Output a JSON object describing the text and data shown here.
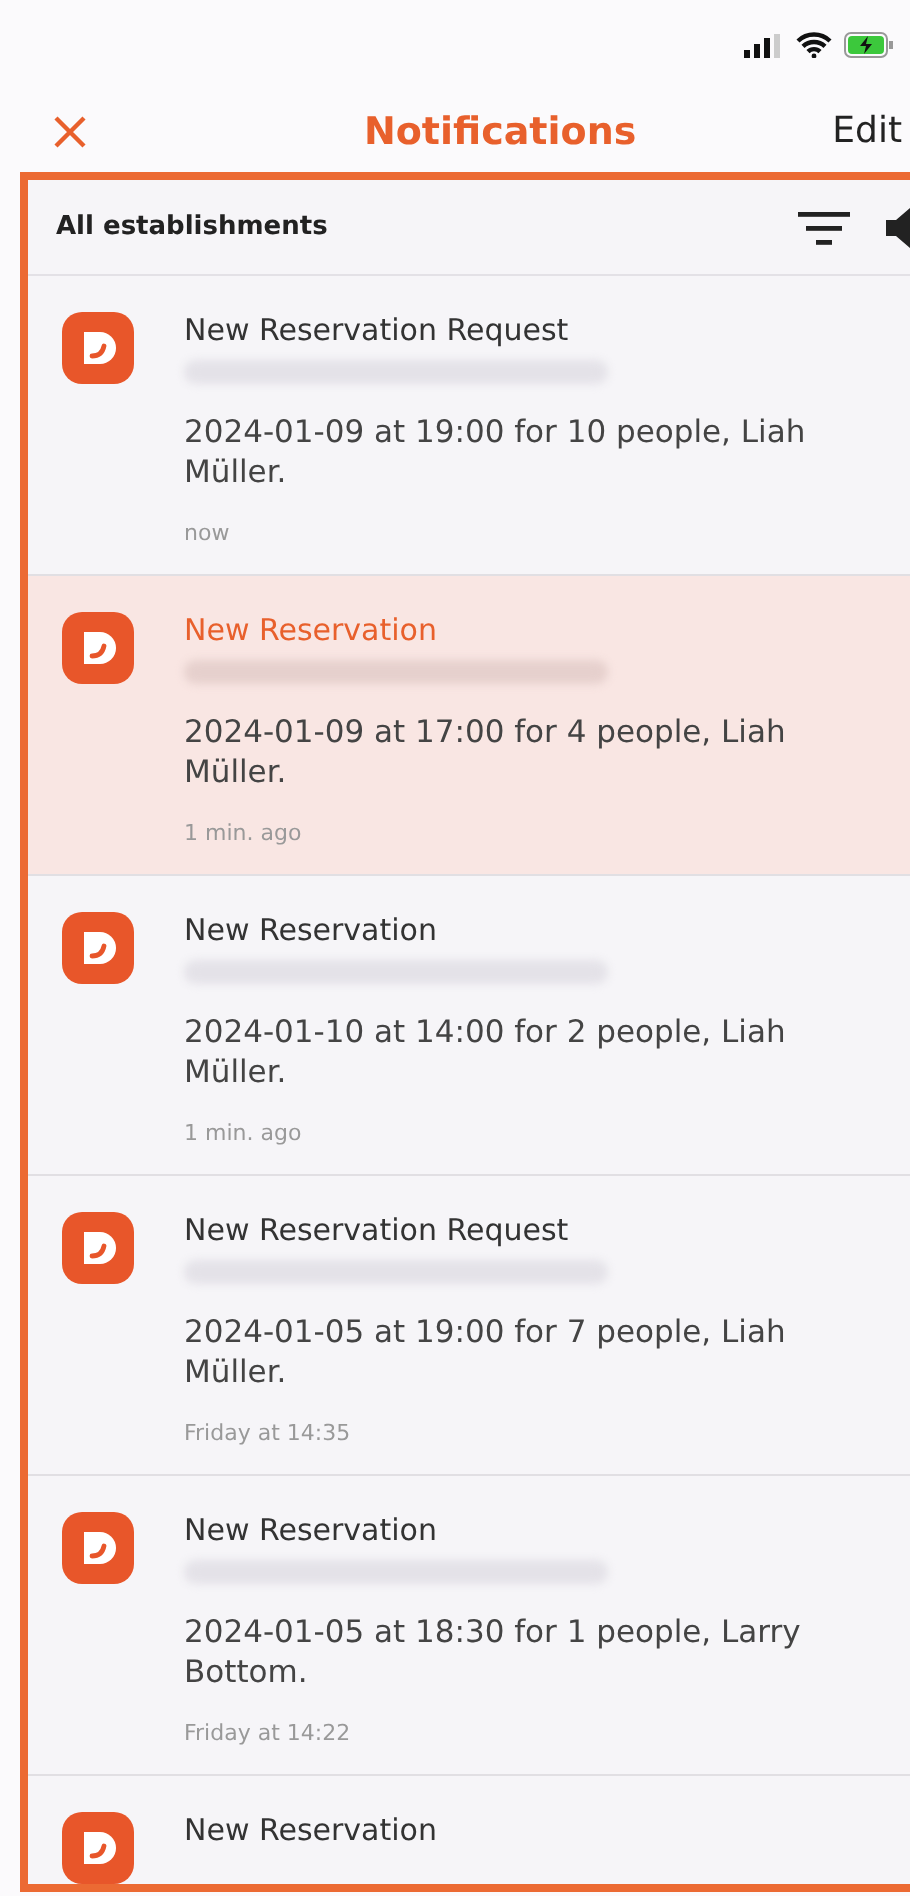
{
  "nav": {
    "title": "Notifications",
    "action": "Edit"
  },
  "filter_bar": {
    "label": "All establishments"
  },
  "notifications": [
    {
      "title": "New Reservation Request",
      "redacted": true,
      "body": "2024-01-09 at 19:00 for 10 people, Liah Müller.",
      "time": "now",
      "highlighted": false
    },
    {
      "title": "New Reservation",
      "redacted": true,
      "body": "2024-01-09 at 17:00 for 4 people, Liah Müller.",
      "time": "1 min. ago",
      "highlighted": true
    },
    {
      "title": "New Reservation",
      "redacted": true,
      "body": "2024-01-10 at 14:00 for 2 people, Liah Müller.",
      "time": "1 min. ago",
      "highlighted": false
    },
    {
      "title": "New Reservation Request",
      "redacted": true,
      "body": "2024-01-05 at 19:00 for 7 people, Liah Müller.",
      "time": "Friday at 14:35",
      "highlighted": false
    },
    {
      "title": "New Reservation",
      "redacted": true,
      "body": "2024-01-05 at 18:30 for 1 people, Larry Bottom.",
      "time": "Friday at 14:22",
      "highlighted": false
    },
    {
      "title": "New Reservation",
      "highlighted": false
    }
  ]
}
